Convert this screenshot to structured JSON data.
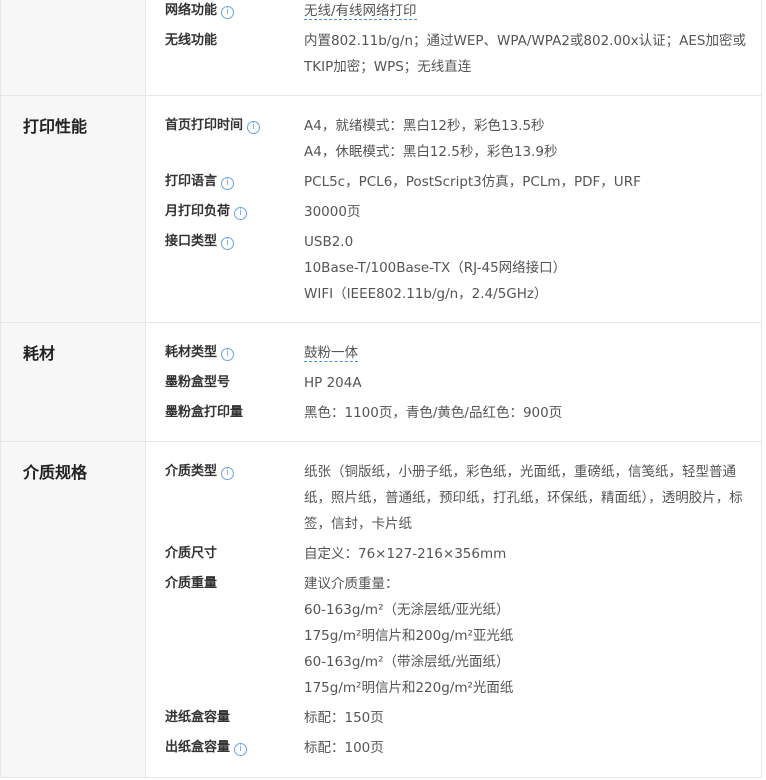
{
  "sections": [
    {
      "category": "",
      "rows": [
        {
          "label": "网络功能",
          "info": true,
          "dashed": true,
          "lines": [
            "无线/有线网络打印"
          ]
        },
        {
          "label": "无线功能",
          "info": false,
          "dashed": false,
          "lines": [
            "内置802.11b/g/n；通过WEP、WPA/WPA2或802.00x认证；AES加密或TKIP加密；WPS；无线直连"
          ]
        }
      ]
    },
    {
      "category": "打印性能",
      "rows": [
        {
          "label": "首页打印时间",
          "info": true,
          "dashed": false,
          "lines": [
            "A4，就绪模式：黑白12秒，彩色13.5秒",
            "A4，休眠模式：黑白12.5秒，彩色13.9秒"
          ]
        },
        {
          "label": "打印语言",
          "info": true,
          "dashed": false,
          "lines": [
            "PCL5c，PCL6，PostScript3仿真，PCLm，PDF，URF"
          ]
        },
        {
          "label": "月打印负荷",
          "info": true,
          "dashed": false,
          "lines": [
            "30000页"
          ]
        },
        {
          "label": "接口类型",
          "info": true,
          "dashed": false,
          "lines": [
            "USB2.0",
            "10Base-T/100Base-TX（RJ-45网络接口）",
            "WIFI（IEEE802.11b/g/n，2.4/5GHz）"
          ]
        }
      ]
    },
    {
      "category": "耗材",
      "rows": [
        {
          "label": "耗材类型",
          "info": true,
          "dashed": true,
          "lines": [
            "鼓粉一体"
          ]
        },
        {
          "label": "墨粉盒型号",
          "info": false,
          "dashed": false,
          "lines": [
            "HP 204A"
          ]
        },
        {
          "label": "墨粉盒打印量",
          "info": false,
          "dashed": false,
          "lines": [
            "黑色：1100页，青色/黄色/品红色：900页"
          ]
        }
      ]
    },
    {
      "category": "介质规格",
      "rows": [
        {
          "label": "介质类型",
          "info": true,
          "dashed": false,
          "lines": [
            "纸张（铜版纸，小册子纸，彩色纸，光面纸，重磅纸，信笺纸，轻型普通纸，照片纸，普通纸，预印纸，打孔纸，环保纸，精面纸），透明胶片，标签，信封，卡片纸"
          ]
        },
        {
          "label": "介质尺寸",
          "info": false,
          "dashed": false,
          "lines": [
            "自定义：76×127-216×356mm"
          ]
        },
        {
          "label": "介质重量",
          "info": false,
          "dashed": false,
          "lines": [
            "建议介质重量：",
            "60-163g/m²（无涂层纸/亚光纸）",
            "175g/m²明信片和200g/m²亚光纸",
            "60-163g/m²（带涂层纸/光面纸）",
            "175g/m²明信片和220g/m²光面纸"
          ]
        },
        {
          "label": "进纸盒容量",
          "info": false,
          "dashed": false,
          "lines": [
            "标配：150页"
          ]
        },
        {
          "label": "出纸盒容量",
          "info": true,
          "dashed": false,
          "lines": [
            "标配：100页"
          ]
        }
      ]
    }
  ],
  "info_glyph": "i"
}
